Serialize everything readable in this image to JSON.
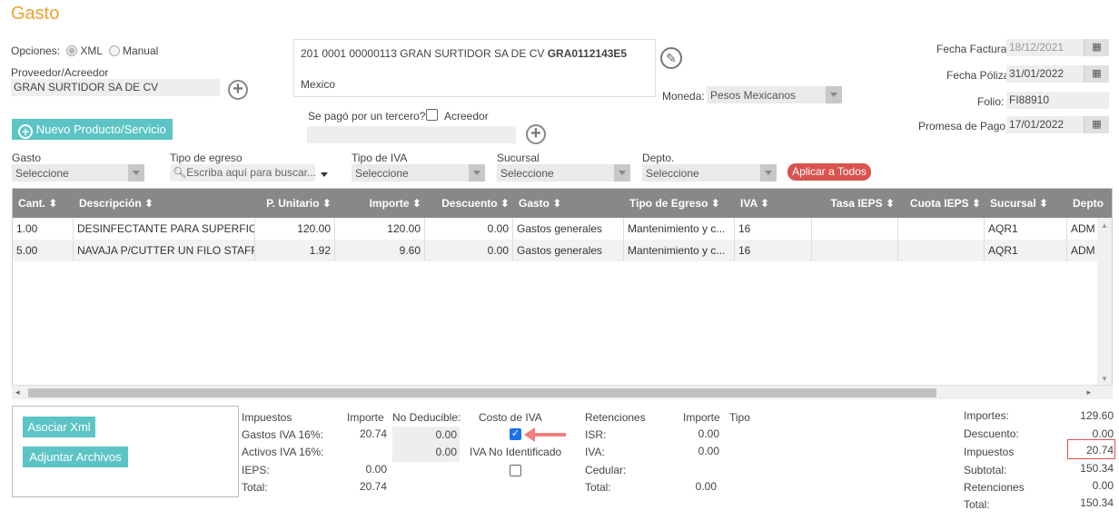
{
  "page": {
    "title": "Gasto"
  },
  "opciones": {
    "label": "Opciones:",
    "xml": "XML",
    "manual": "Manual"
  },
  "proveedor": {
    "label": "Proveedor/Acreedor",
    "value": "GRAN SURTIDOR SA DE CV"
  },
  "address": {
    "line1": "201 0001 00000113 GRAN SURTIDOR SA DE CV ",
    "rfc": "GRA0112143E5",
    "line2": "Mexico"
  },
  "moneda": {
    "label": "Moneda:",
    "value": "Pesos Mexicanos"
  },
  "tercero": {
    "label": "Se pagó por un tercero?",
    "acreedor": "Acreedor"
  },
  "nuevo_btn": "Nuevo Producto/Servicio",
  "fechas": {
    "factura_label": "Fecha Factura:",
    "factura": "18/12/2021",
    "poliza_label": "Fecha Póliza",
    "poliza": "31/01/2022",
    "folio_label": "Folio:",
    "folio": "FI88910",
    "promesa_label": "Promesa de Pago:",
    "promesa": "17/01/2022"
  },
  "filters": {
    "gasto_label": "Gasto",
    "gasto": "Seleccione",
    "tipo_egreso_label": "Tipo de egreso",
    "tipo_egreso_placeholder": "Escriba aquí para buscar...",
    "tipo_iva_label": "Tipo de IVA",
    "tipo_iva": "Seleccione",
    "sucursal_label": "Sucursal",
    "sucursal": "Seleccione",
    "depto_label": "Depto.",
    "depto": "Seleccione",
    "aplicar": "Aplicar a Todos"
  },
  "table": {
    "headers": [
      "Cant. ⬍",
      "Descripción ⬍",
      "P. Unitario ⬍",
      "Importe ⬍",
      "Descuento ⬍",
      "Gasto ⬍",
      "Tipo de Egreso ⬍",
      "IVA ⬍",
      "Tasa IEPS ⬍",
      "Cuota IEPS ⬍",
      "Sucursal ⬍",
      "Depto"
    ],
    "rows": [
      [
        "1.00",
        "DESINFECTANTE PARA SUPERFICIE...",
        "120.00",
        "120.00",
        "0.00",
        "Gastos generales",
        "Mantenimiento y c...",
        "16",
        "",
        "",
        "AQR1",
        "ADM"
      ],
      [
        "5.00",
        "NAVAJA P/CUTTER UN FILO STAFFO",
        "1.92",
        "9.60",
        "0.00",
        "Gastos generales",
        "Mantenimiento y c...",
        "16",
        "",
        "",
        "AQR1",
        "ADM"
      ]
    ]
  },
  "actions": {
    "asociar": "Asociar Xml",
    "adjuntar": "Adjuntar Archivos"
  },
  "impuestos": {
    "header": "Impuestos",
    "importe_h": "Importe",
    "nodeducible_h": "No Deducible:",
    "gastos_label": "Gastos IVA 16%:",
    "gastos_imp": "20.74",
    "gastos_nd": "0.00",
    "activos_label": "Activos IVA 16%:",
    "activos_nd": "0.00",
    "ieps_label": "IEPS:",
    "ieps": "0.00",
    "total_label": "Total:",
    "total": "20.74"
  },
  "costo_iva": {
    "label": "Costo de IVA",
    "no_identificado": "IVA No Identificado"
  },
  "retenciones": {
    "header": "Retenciones",
    "importe_h": "Importe",
    "tipo_h": "Tipo",
    "isr_label": "ISR:",
    "isr": "0.00",
    "iva_label": "IVA:",
    "iva": "0.00",
    "cedular_label": "Cedular:",
    "total_label": "Total:",
    "total": "0.00"
  },
  "totales": {
    "importes_label": "Importes:",
    "importes": "129.60",
    "descuento_label": "Descuento:",
    "descuento": "0.00",
    "impuestos_label": "Impuestos",
    "impuestos": "20.74",
    "subtotal_label": "Subtotal:",
    "subtotal": "150.34",
    "retenciones_label": "Retenciones",
    "retenciones": "0.00",
    "total_label": "Total:",
    "total": "150.34"
  }
}
